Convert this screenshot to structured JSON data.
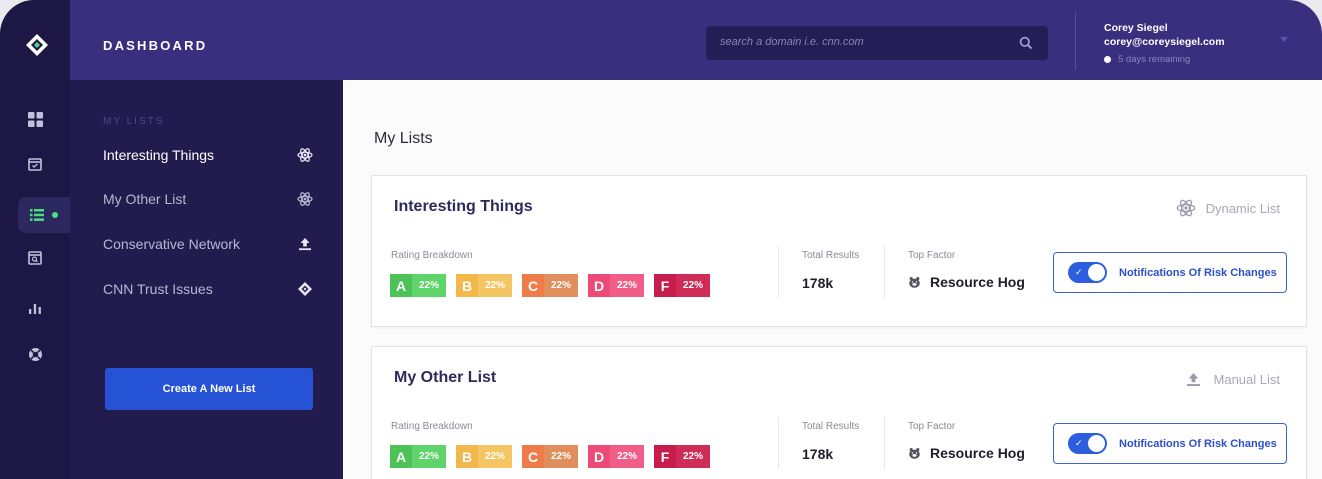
{
  "header": {
    "title": "DASHBOARD",
    "search_placeholder": "search a domain i.e. cnn.com",
    "user_name": "Corey Siegel",
    "user_email": "corey@coreysiegel.com",
    "trial_text": "5 days remaining"
  },
  "rail": {
    "icons": [
      "grid-icon",
      "calendar-icon",
      "list-icon",
      "browser-search-icon",
      "bar-chart-icon",
      "lifebuoy-icon"
    ],
    "active": "list-icon",
    "active_dot_color": "#4ade80"
  },
  "sidebar": {
    "heading": "MY LISTS",
    "items": [
      {
        "label": "Interesting Things",
        "icon": "atom-icon"
      },
      {
        "label": "My Other List",
        "icon": "atom-icon"
      },
      {
        "label": "Conservative Network",
        "icon": "upload-icon"
      },
      {
        "label": "CNN Trust Issues",
        "icon": "diamond-logo-icon"
      }
    ],
    "create_button": "Create A New List"
  },
  "main": {
    "page_title": "My Lists",
    "labels": {
      "rating": "Rating Breakdown",
      "total": "Total Results",
      "factor": "Top Factor",
      "notify": "Notifications Of Risk Changes"
    },
    "grade_colors": {
      "A": "#4cc257",
      "B": "#f2b84a",
      "C": "#ee7c48",
      "D": "#ee4a78",
      "F": "#c71d4c"
    },
    "cards": [
      {
        "title": "Interesting Things",
        "type": "Dynamic List",
        "type_icon": "atom-icon",
        "grades": [
          {
            "letter": "A",
            "percent": "22%"
          },
          {
            "letter": "B",
            "percent": "22%"
          },
          {
            "letter": "C",
            "percent": "22%"
          },
          {
            "letter": "D",
            "percent": "22%"
          },
          {
            "letter": "F",
            "percent": "22%"
          }
        ],
        "total": "178k",
        "factor": "Resource Hog",
        "notifications_on": true
      },
      {
        "title": "My Other List",
        "type": "Manual List",
        "type_icon": "upload-icon",
        "grades": [
          {
            "letter": "A",
            "percent": "22%"
          },
          {
            "letter": "B",
            "percent": "22%"
          },
          {
            "letter": "C",
            "percent": "22%"
          },
          {
            "letter": "D",
            "percent": "22%"
          },
          {
            "letter": "F",
            "percent": "22%"
          }
        ],
        "total": "178k",
        "factor": "Resource Hog",
        "notifications_on": true
      }
    ]
  }
}
